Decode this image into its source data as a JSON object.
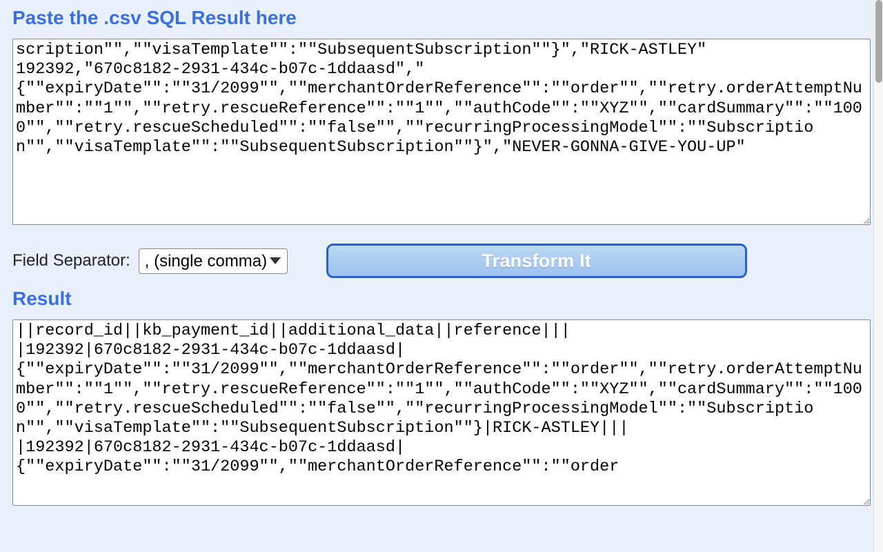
{
  "titles": {
    "input": "Paste the .csv SQL Result here",
    "result": "Result"
  },
  "controls": {
    "field_separator_label": "Field Separator:",
    "separator_selected": ", (single comma)",
    "separator_options": [
      ", (single comma)"
    ],
    "transform_button": "Transform It"
  },
  "input_text": "scription\"\",\"\"visaTemplate\"\":\"\"SubsequentSubscription\"\"}\",\"RICK-ASTLEY\"\n192392,\"670c8182-2931-434c-b07c-1ddaasd\",\"\n{\"\"expiryDate\"\":\"\"31/2099\"\",\"\"merchantOrderReference\"\":\"\"order\"\",\"\"retry.orderAttemptNumber\"\":\"\"1\"\",\"\"retry.rescueReference\"\":\"\"1\"\",\"\"authCode\"\":\"\"XYZ\"\",\"\"cardSummary\"\":\"\"1000\"\",\"\"retry.rescueScheduled\"\":\"\"false\"\",\"\"recurringProcessingModel\"\":\"\"Subscription\"\",\"\"visaTemplate\"\":\"\"SubsequentSubscription\"\"}\",\"NEVER-GONNA-GIVE-YOU-UP\"",
  "result_text": "||record_id||kb_payment_id||additional_data||reference|||\n|192392|670c8182-2931-434c-b07c-1ddaasd|\n{\"\"expiryDate\"\":\"\"31/2099\"\",\"\"merchantOrderReference\"\":\"\"order\"\",\"\"retry.orderAttemptNumber\"\":\"\"1\"\",\"\"retry.rescueReference\"\":\"\"1\"\",\"\"authCode\"\":\"\"XYZ\"\",\"\"cardSummary\"\":\"\"1000\"\",\"\"retry.rescueScheduled\"\":\"\"false\"\",\"\"recurringProcessingModel\"\":\"\"Subscription\"\",\"\"visaTemplate\"\":\"\"SubsequentSubscription\"\"}|RICK-ASTLEY|||\n|192392|670c8182-2931-434c-b07c-1ddaasd|\n{\"\"expiryDate\"\":\"\"31/2099\"\",\"\"merchantOrderReference\"\":\"\"order"
}
